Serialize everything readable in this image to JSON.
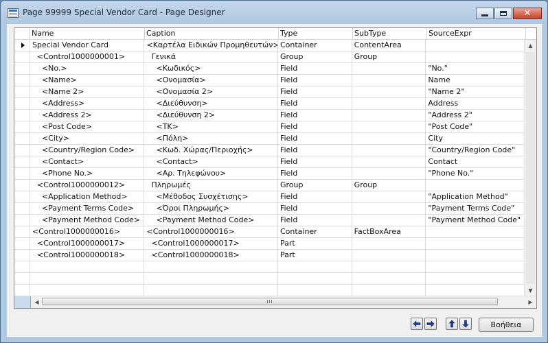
{
  "window": {
    "title": "Page 99999 Special Vendor Card - Page Designer",
    "icon": "table-icon",
    "controls": [
      "minimize-icon",
      "maximize-icon",
      "close-icon"
    ]
  },
  "grid": {
    "columns": [
      "Name",
      "Caption",
      "Type",
      "SubType",
      "SourceExpr"
    ],
    "rows": [
      {
        "name": "Special Vendor Card",
        "caption": "<Καρτέλα Ειδικών Προμηθευτών>",
        "type": "Container",
        "subtype": "ContentArea",
        "source": ""
      },
      {
        "name": "  <Control1000000001>",
        "caption": "  Γενικά",
        "type": "Group",
        "subtype": "Group",
        "source": ""
      },
      {
        "name": "    <No.>",
        "caption": "    <Κωδικός>",
        "type": "Field",
        "subtype": "",
        "source": "\"No.\""
      },
      {
        "name": "    <Name>",
        "caption": "    <Ονομασία>",
        "type": "Field",
        "subtype": "",
        "source": "Name"
      },
      {
        "name": "    <Name 2>",
        "caption": "    <Ονομασία 2>",
        "type": "Field",
        "subtype": "",
        "source": "\"Name 2\""
      },
      {
        "name": "    <Address>",
        "caption": "    <Διεύθυνση>",
        "type": "Field",
        "subtype": "",
        "source": "Address"
      },
      {
        "name": "    <Address 2>",
        "caption": "    <Διεύθυνση 2>",
        "type": "Field",
        "subtype": "",
        "source": "\"Address 2\""
      },
      {
        "name": "    <Post Code>",
        "caption": "    <ΤΚ>",
        "type": "Field",
        "subtype": "",
        "source": "\"Post Code\""
      },
      {
        "name": "    <City>",
        "caption": "    <Πόλη>",
        "type": "Field",
        "subtype": "",
        "source": "City"
      },
      {
        "name": "    <Country/Region Code>",
        "caption": "    <Κωδ. Χώρας/Περιοχής>",
        "type": "Field",
        "subtype": "",
        "source": "\"Country/Region Code\""
      },
      {
        "name": "    <Contact>",
        "caption": "    <Contact>",
        "type": "Field",
        "subtype": "",
        "source": "Contact"
      },
      {
        "name": "    <Phone No.>",
        "caption": "    <Αρ. Τηλεφώνου>",
        "type": "Field",
        "subtype": "",
        "source": "\"Phone No.\""
      },
      {
        "name": "  <Control1000000012>",
        "caption": "  Πληρωμές",
        "type": "Group",
        "subtype": "Group",
        "source": ""
      },
      {
        "name": "    <Application Method>",
        "caption": "    <Μέθοδος Συσχέτισης>",
        "type": "Field",
        "subtype": "",
        "source": "\"Application Method\""
      },
      {
        "name": "    <Payment Terms Code>",
        "caption": "    <Όροι Πληρωμής>",
        "type": "Field",
        "subtype": "",
        "source": "\"Payment Terms Code\""
      },
      {
        "name": "    <Payment Method Code>",
        "caption": "    <Payment Method Code>",
        "type": "Field",
        "subtype": "",
        "source": "\"Payment Method Code\""
      },
      {
        "name": "<Control1000000016>",
        "caption": "<Control1000000016>",
        "type": "Container",
        "subtype": "FactBoxArea",
        "source": ""
      },
      {
        "name": "  <Control1000000017>",
        "caption": "  <Control1000000017>",
        "type": "Part",
        "subtype": "",
        "source": ""
      },
      {
        "name": "  <Control1000000018>",
        "caption": "  <Control1000000018>",
        "type": "Part",
        "subtype": "",
        "source": ""
      },
      {
        "name": "",
        "caption": "",
        "type": "",
        "subtype": "",
        "source": ""
      },
      {
        "name": "",
        "caption": "",
        "type": "",
        "subtype": "",
        "source": ""
      },
      {
        "name": "",
        "caption": "",
        "type": "",
        "subtype": "",
        "source": ""
      }
    ],
    "current_row": 0
  },
  "footer": {
    "nav_buttons": [
      "arrow-left-icon",
      "arrow-right-icon",
      "arrow-up-icon",
      "arrow-down-icon"
    ],
    "help_label": "Βοήθεια"
  }
}
